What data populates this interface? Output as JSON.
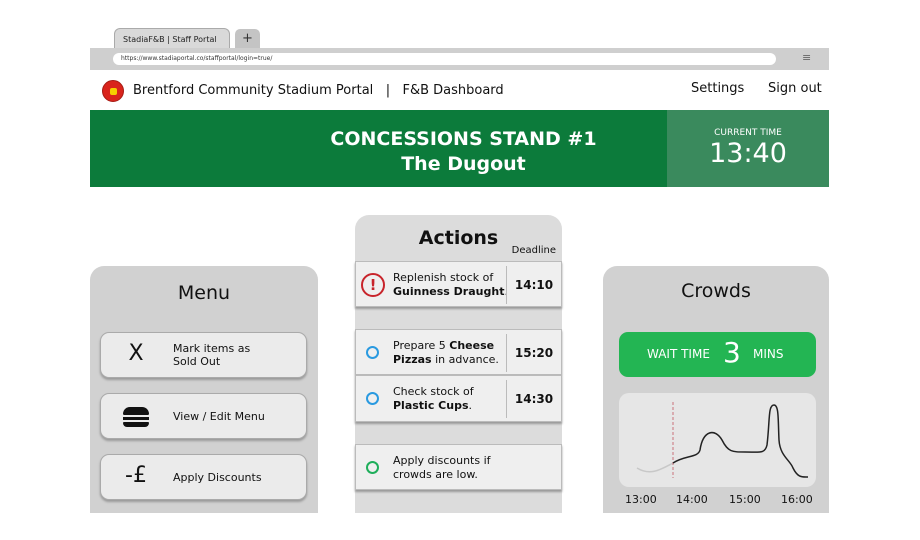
{
  "browser": {
    "tab_title": "StadiaF&B | Staff Portal",
    "new_tab": "+",
    "url": "https://www.stadiaportal.co/staffportal/login=true/",
    "menu_icon": "hamburger-icon"
  },
  "header": {
    "title": "Brentford Community Stadium Portal",
    "separator": "|",
    "section": "F&B Dashboard",
    "settings": "Settings",
    "signout": "Sign out"
  },
  "banner": {
    "line1": "CONCESSIONS STAND #1",
    "line2": "The Dugout",
    "time_label": "CURRENT TIME",
    "time": "13:40"
  },
  "menu": {
    "title": "Menu",
    "buttons": [
      {
        "icon": "X",
        "label1": "Mark items as",
        "label2": "Sold Out"
      },
      {
        "icon": "burger-icon",
        "label1": "View / Edit Menu"
      },
      {
        "icon": "-£",
        "label1": "Apply Discounts"
      }
    ]
  },
  "actions": {
    "title": "Actions",
    "deadline_header": "Deadline",
    "items": [
      {
        "status": "urgent",
        "a": "Replenish stock of ",
        "b": "Guinness Draught",
        "c": ".",
        "deadline": "14:10"
      },
      {
        "status": "pending",
        "a": "Prepare 5 ",
        "b": "Cheese Pizzas",
        "c": " in advance.",
        "deadline": "15:20"
      },
      {
        "status": "pending",
        "a": "Check stock of ",
        "b": "Plastic Cups",
        "c": ".",
        "deadline": "14:30"
      },
      {
        "status": "suggestion",
        "a": "Apply discounts if crowds are low.",
        "b": "",
        "c": ""
      }
    ]
  },
  "crowds": {
    "title": "Crowds",
    "wait_label": "WAIT TIME",
    "wait_value": "3",
    "wait_unit": "MINS",
    "ticks": [
      "13:00",
      "14:00",
      "15:00",
      "16:00"
    ]
  },
  "colors": {
    "brand_green": "#0c7b3b",
    "wait_green": "#23b553",
    "urgent_red": "#c8242b",
    "pending_blue": "#2a9ae0",
    "suggestion_green": "#1fae5b"
  }
}
